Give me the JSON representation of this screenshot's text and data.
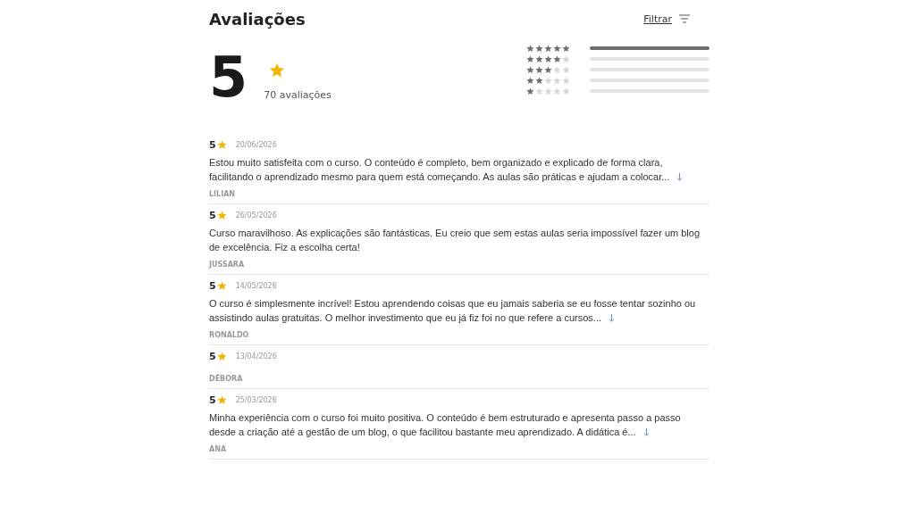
{
  "title": "Avaliações",
  "filter": {
    "label": "Filtrar"
  },
  "summary": {
    "score": "5",
    "count": "70 avaliações",
    "distribution": [
      {
        "stars": 5,
        "level": 1
      },
      {
        "stars": 4,
        "level": 0
      },
      {
        "stars": 3,
        "level": 0
      },
      {
        "stars": 2,
        "level": 0
      },
      {
        "stars": 1,
        "level": 0
      }
    ]
  },
  "reviews": [
    {
      "rating": "5",
      "date": "20/06/2026",
      "text": "Estou muito satisfeita com o curso. O conteúdo é completo, bem organizado e explicado de forma clara, facilitando o aprendizado mesmo para quem está começando. As aulas são práticas e ajudam a colocar...",
      "truncated": true,
      "author": "LILIAN"
    },
    {
      "rating": "5",
      "date": "26/05/2026",
      "text": "Curso maravilhoso. As explicações são fantásticas. Eu creio que sem estas aulas seria impossível fazer um blog de excelência. Fiz a escolha certa!",
      "truncated": false,
      "author": "JUSSARA"
    },
    {
      "rating": "5",
      "date": "14/05/2026",
      "text": "O curso é simplesmente incrível! Estou aprendendo coisas que eu jamais saberia se eu fosse tentar sozinho ou assistindo aulas gratuitas. O melhor investimento que eu já fiz foi no que refere a cursos...",
      "truncated": true,
      "author": "RONALDO"
    },
    {
      "rating": "5",
      "date": "13/04/2026",
      "author": "DÉBORA"
    },
    {
      "rating": "5",
      "date": "25/03/2026",
      "text": "Minha experiência com o curso foi muito positiva. O conteúdo é bem estruturado e apresenta passo a passo desde a criação até a gestão de um blog, o que facilitou bastante meu aprendizado. A didática é...",
      "truncated": true,
      "author": "ANA"
    }
  ]
}
